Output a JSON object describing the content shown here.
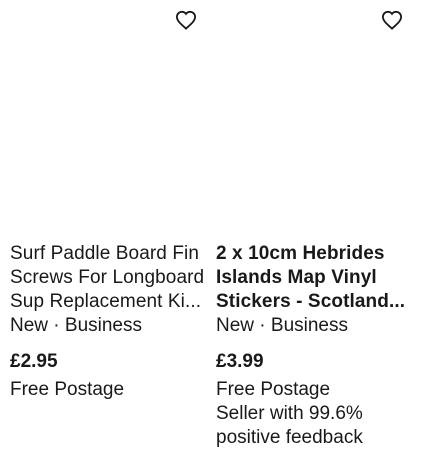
{
  "listings": [
    {
      "title_lines": [
        "Surf Paddle Board Fin",
        "Screws For Longboard",
        "Sup Replacement Ki..."
      ],
      "condition": "New · Business",
      "price": "£2.95",
      "shipping": "Free Postage",
      "seller_lines": [],
      "watch_icon": "heart-outline-icon"
    },
    {
      "title_lines": [
        "2 x 10cm Hebrides",
        "Islands Map Vinyl",
        "Stickers - Scotland..."
      ],
      "condition": "New · Business",
      "price": "£3.99",
      "shipping": "Free Postage",
      "seller_lines": [
        "Seller with 99.6%",
        "positive feedback"
      ],
      "watch_icon": "heart-outline-icon"
    }
  ],
  "colors": {
    "text": "#191919",
    "background": "#ffffff"
  }
}
